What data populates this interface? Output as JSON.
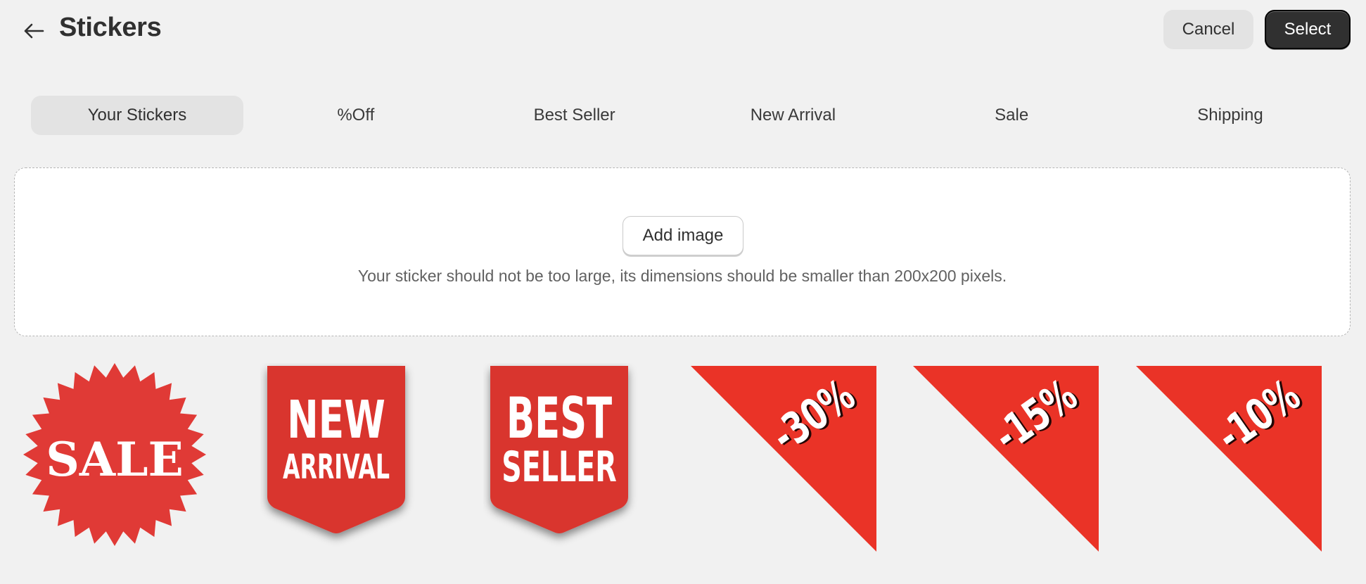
{
  "header": {
    "title": "Stickers",
    "cancel_label": "Cancel",
    "select_label": "Select"
  },
  "tabs": [
    {
      "label": "Your Stickers",
      "active": true
    },
    {
      "label": "%Off",
      "active": false
    },
    {
      "label": "Best Seller",
      "active": false
    },
    {
      "label": "New Arrival",
      "active": false
    },
    {
      "label": "Sale",
      "active": false
    },
    {
      "label": "Shipping",
      "active": false
    }
  ],
  "upload": {
    "button_label": "Add image",
    "hint": "Your sticker should not be too large, its dimensions should be smaller than 200x200 pixels."
  },
  "stickers": [
    {
      "kind": "starburst",
      "text": "SALE",
      "color": "#e03a36"
    },
    {
      "kind": "ribbon",
      "line1": "NEW",
      "line2": "ARRIVAL",
      "color": "#e03a36"
    },
    {
      "kind": "ribbon",
      "line1": "BEST",
      "line2": "SELLER",
      "color": "#e03a36"
    },
    {
      "kind": "corner",
      "text": "-30%",
      "color": "#ea3327"
    },
    {
      "kind": "corner",
      "text": "-15%",
      "color": "#ea3327"
    },
    {
      "kind": "corner",
      "text": "-10%",
      "color": "#ea3327"
    }
  ],
  "icons": {
    "back": "arrow-left-icon"
  }
}
